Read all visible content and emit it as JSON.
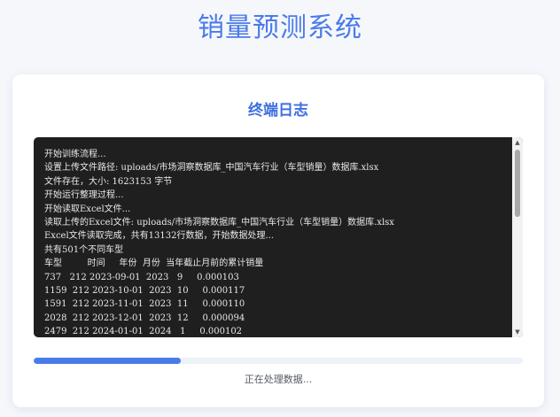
{
  "app": {
    "title": "销量预测系统"
  },
  "card": {
    "title": "终端日志"
  },
  "terminal": {
    "lines": [
      "开始训练流程...",
      "设置上传文件路径: uploads/市场洞察数据库_中国汽车行业（车型销量）数据库.xlsx",
      "文件存在，大小: 1623153 字节",
      "开始运行整理过程...",
      "开始读取Excel文件...",
      "读取上传的Excel文件: uploads/市场洞察数据库_中国汽车行业（车型销量）数据库.xlsx",
      "Excel文件读取完成，共有13132行数据，开始数据处理...",
      "共有501个不同车型",
      "车型         时间     年份  月份  当年截止月前的累计销量",
      "737   212 2023-09-01  2023   9     0.000103",
      "1159  212 2023-10-01  2023  10     0.000117",
      "1591  212 2023-11-01  2023  11     0.000110",
      "2028  212 2023-12-01  2023  12     0.000094",
      "2479  212 2024-01-01  2024   1     0.000102"
    ],
    "scroll_up_icon": "triangle-up-icon",
    "scroll_down_icon": "triangle-down-icon"
  },
  "progress": {
    "value": 0.3,
    "color": "#4a7bea"
  },
  "status": {
    "text": "正在处理数据..."
  },
  "colors": {
    "accent": "#4a7bea",
    "terminal_bg": "#1f1f1f"
  }
}
